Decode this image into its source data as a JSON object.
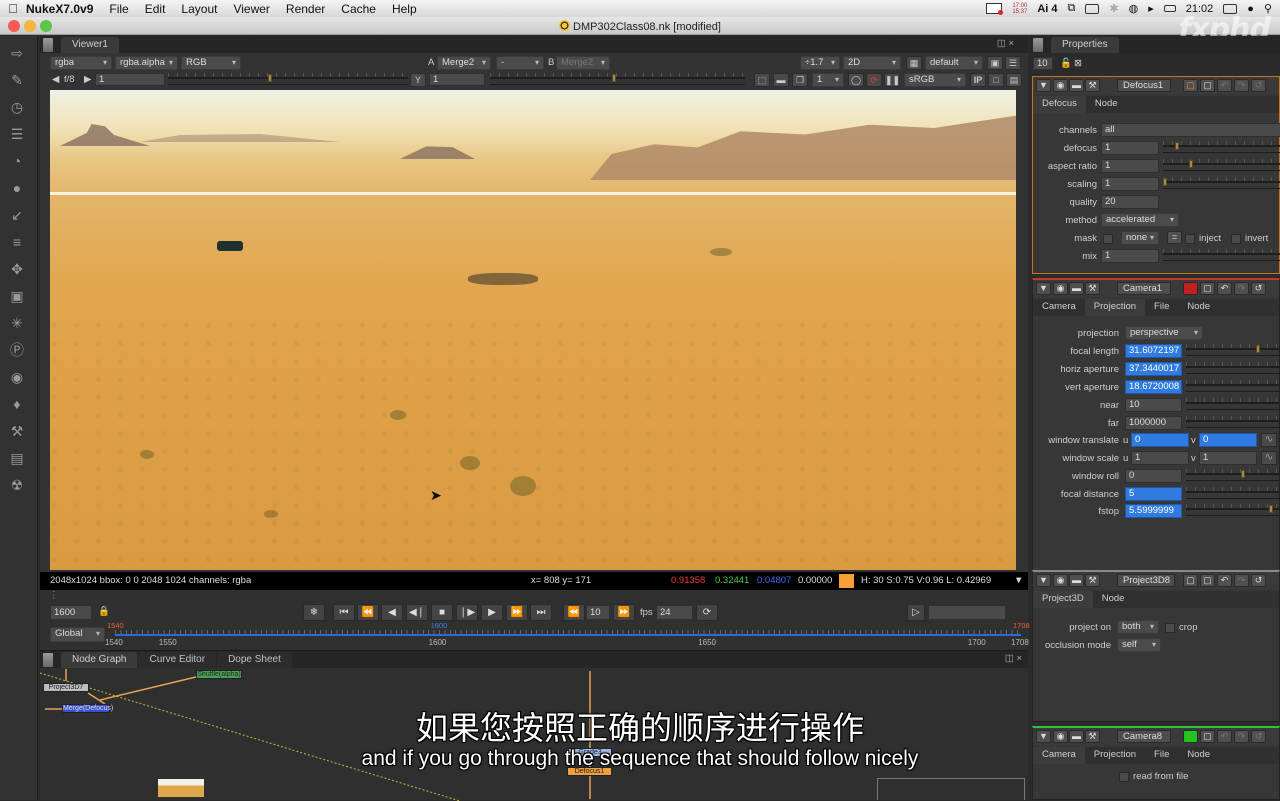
{
  "menubar": {
    "app_name": "NukeX7.0v9",
    "items": [
      "File",
      "Edit",
      "Layout",
      "Viewer",
      "Render",
      "Cache",
      "Help"
    ],
    "status_time_small_top": "17:00",
    "status_time_small_bottom": "15:37",
    "adobe_badge": "4",
    "clock": "21:02",
    "icons": [
      "apple-icon",
      "video-record-icon",
      "adobe-cc-icon",
      "dropbox-icon",
      "display-icon",
      "bluetooth-icon",
      "wifi-icon",
      "volume-icon",
      "battery-icon",
      "keyboard-icon",
      "user-icon",
      "search-icon"
    ]
  },
  "window": {
    "title": "DMP302Class08.nk [modified]",
    "watermark": "fxphd"
  },
  "left_toolbar": {
    "icons": [
      "image-icon",
      "draw-icon",
      "time-icon",
      "channel-icon",
      "color-icon",
      "filter-icon",
      "keyer-icon",
      "merge-icon",
      "transform-icon",
      "3d-icon",
      "particles-icon",
      "deep-icon",
      "views-icon",
      "metadata-icon",
      "other-icon",
      "furnace-icon",
      "ofx-icon"
    ]
  },
  "viewer": {
    "tab_label": "Viewer1",
    "channels": "rgba",
    "alpha_channel": "rgba.alpha",
    "display": "RGB",
    "a_label": "A",
    "a_input": "Merge2",
    "compare_mode": "-",
    "b_label": "B",
    "b_input": "Merge2",
    "zoom": "÷1.7",
    "view_mode": "2D",
    "lut_preset": "default",
    "fstop_label": "f/8",
    "gain_value": "1",
    "gamma_label": "Y",
    "gamma_value": "1",
    "proxy_value": "1",
    "colorspace": "sRGB",
    "ip_label": "IP",
    "info": {
      "format": "2048x1024 bbox: 0 0 2048 1024 channels: rgba",
      "coords": "x= 808 y= 171",
      "r": "0.91358",
      "g": "0.32441",
      "b": "0.04807",
      "a": "0.00000",
      "swatch_color": "#f7a03a",
      "hsvl": "H: 30 S:0.75 V:0.96  L: 0.42969"
    }
  },
  "timeline": {
    "current_frame": "1600",
    "range_mode": "Global",
    "step": "10",
    "fps_label": "fps",
    "fps": "24",
    "in_point": "1540",
    "out_point": "1708",
    "playhead": "1600",
    "tick_labels": [
      "1540",
      "1550",
      "1600",
      "1650",
      "1700",
      "1708"
    ],
    "frame_min": 1540,
    "frame_max": 1708
  },
  "node_graph": {
    "tabs": [
      "Node Graph",
      "Curve Editor",
      "Dope Sheet"
    ],
    "nodes": [
      {
        "label": "Project3D7",
        "color": "#bdbdbd"
      },
      {
        "label": "Merge(Defocus)",
        "color": "#3a4fd0"
      },
      {
        "label": "Shuffle(alpha)",
        "color": "#4aa257"
      },
      {
        "label": "Grade3",
        "color": "#9db8e6"
      },
      {
        "label": "Defocus1",
        "color": "#f0a040"
      }
    ]
  },
  "subtitles": {
    "chinese": "如果您按照正确的顺序进行操作",
    "english": "and if you go through the sequence that should follow nicely"
  },
  "properties": {
    "tab_label": "Properties",
    "max_panels": "10",
    "panels": [
      {
        "name": "Defocus1",
        "tabs": [
          "Defocus",
          "Node"
        ],
        "active_tab": 0,
        "params": {
          "channels_label": "channels",
          "channels": "all",
          "defocus_label": "defocus",
          "defocus": "1",
          "aspect_label": "aspect ratio",
          "aspect": "1",
          "scaling_label": "scaling",
          "scaling": "1",
          "quality_label": "quality",
          "quality": "20",
          "method_label": "method",
          "method": "accelerated",
          "mask_label": "mask",
          "mask": "none",
          "inject_label": "inject",
          "invert_label": "invert",
          "mix_label": "mix",
          "mix": "1"
        }
      },
      {
        "name": "Camera1",
        "tabs": [
          "Camera",
          "Projection",
          "File",
          "Node"
        ],
        "active_tab": 1,
        "params": {
          "projection_label": "projection",
          "projection": "perspective",
          "focal_label": "focal length",
          "focal": "31.6072197",
          "haperture_label": "horiz aperture",
          "haperture": "37.3440017",
          "vaperture_label": "vert aperture",
          "vaperture": "18.6720008",
          "near_label": "near",
          "near": "10",
          "far_label": "far",
          "far": "1000000",
          "wtranslate_label": "window translate",
          "wtranslate_u": "0",
          "wtranslate_v": "0",
          "wscale_label": "window scale",
          "wscale_u": "1",
          "wscale_v": "1",
          "wroll_label": "window roll",
          "wroll": "0",
          "focaldist_label": "focal distance",
          "focaldist": "5",
          "fstop_label": "fstop",
          "fstop": "5.5999999",
          "u": "u",
          "v": "v"
        }
      },
      {
        "name": "Project3D8",
        "tabs": [
          "Project3D",
          "Node"
        ],
        "active_tab": 0,
        "params": {
          "projecton_label": "project on",
          "projecton": "both",
          "crop_label": "crop",
          "occlusion_label": "occlusion mode",
          "occlusion": "self"
        }
      },
      {
        "name": "Camera8",
        "tabs": [
          "Camera",
          "Projection",
          "File",
          "Node"
        ],
        "active_tab": 0,
        "params": {
          "readfile_label": "read from file"
        }
      }
    ]
  }
}
